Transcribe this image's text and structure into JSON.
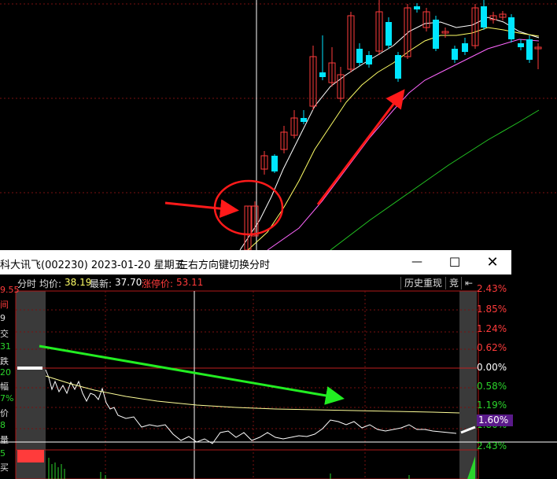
{
  "window": {
    "title": "科大讯飞(002230) 2023-01-20 星期五",
    "hint": "左右方向键切换分时",
    "min_icon": "minimize-icon",
    "max_icon": "maximize-icon",
    "close_icon": "close-icon"
  },
  "header": {
    "mode_label": "分时",
    "avg_label": "均价:",
    "avg_value": "38.19",
    "latest_label": "最新:",
    "latest_value": "37.70",
    "limit_label": "涨停价:",
    "limit_value": "53.11",
    "history_button": "历史重现",
    "bid_button": "竞",
    "expand_icon": "panel-collapse-icon"
  },
  "right_axis": [
    {
      "label": "2.43%",
      "color": "#ff3b3b"
    },
    {
      "label": "1.85%",
      "color": "#ff3b3b"
    },
    {
      "label": "1.24%",
      "color": "#ff3b3b"
    },
    {
      "label": "0.62%",
      "color": "#ff3b3b"
    },
    {
      "label": "0.00%",
      "color": "#ffffff"
    },
    {
      "label": "0.58%",
      "color": "#2bd42b"
    },
    {
      "label": "1.19%",
      "color": "#2bd42b"
    },
    {
      "label": "1.80%",
      "color": "#2bd42b"
    },
    {
      "label": "2.43%",
      "color": "#2bd42b"
    }
  ],
  "current_tag": "1.60%",
  "left_fragments": [
    {
      "text": "9.55",
      "color": "#ff3b3b"
    },
    {
      "text": "间",
      "color": "#ff3b3b"
    },
    {
      "text": "9",
      "color": "#ddd"
    },
    {
      "text": "交",
      "color": "#ddd"
    },
    {
      "text": "31",
      "color": "#2bd42b"
    },
    {
      "text": "跌",
      "color": "#ddd"
    },
    {
      "text": "20",
      "color": "#2bd42b"
    },
    {
      "text": "幅",
      "color": "#ddd"
    },
    {
      "text": "7%",
      "color": "#2bd42b"
    },
    {
      "text": "价",
      "color": "#ddd"
    },
    {
      "text": "8",
      "color": "#2bd42b"
    },
    {
      "text": "量",
      "color": "#ddd"
    },
    {
      "text": "5",
      "color": "#2bd42b"
    },
    {
      "text": "买",
      "color": "#ddd"
    }
  ],
  "colors": {
    "up": "#ff3b3b",
    "down": "#00e5ff",
    "ma5": "#ffffff",
    "ma10": "#ffff66",
    "ma20": "#ff66ff",
    "ma60": "#22c422",
    "annot_red": "#ff1a1a",
    "annot_green": "#22ee22"
  }
}
